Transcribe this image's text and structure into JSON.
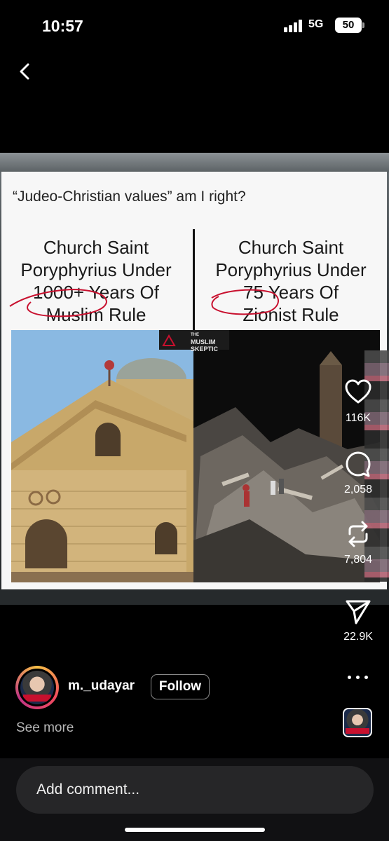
{
  "status_bar": {
    "time": "10:57",
    "network": "5G",
    "battery": "50"
  },
  "post": {
    "caption": "“Judeo-Christian values” am I right?",
    "left_panel": {
      "lines": [
        "Church Saint",
        "Poryphyrius Under",
        "1000+ Years Of",
        "Muslim Rule"
      ]
    },
    "right_panel": {
      "lines": [
        "Church Saint",
        "Poryphyrius Under",
        "75 Years Of",
        "Zionist Rule"
      ]
    },
    "watermark": [
      "THE",
      "MUSLIM",
      "SKEPTIC"
    ]
  },
  "actions": {
    "likes": "116K",
    "comments": "2,058",
    "reposts": "7,804",
    "shares": "22.9K"
  },
  "author": {
    "username": "m._udayar",
    "follow_label": "Follow",
    "see_more": "See more"
  },
  "comment_bar": {
    "placeholder": "Add comment..."
  },
  "colors": {
    "background": "#000000",
    "annotation_red": "#c8102e"
  }
}
